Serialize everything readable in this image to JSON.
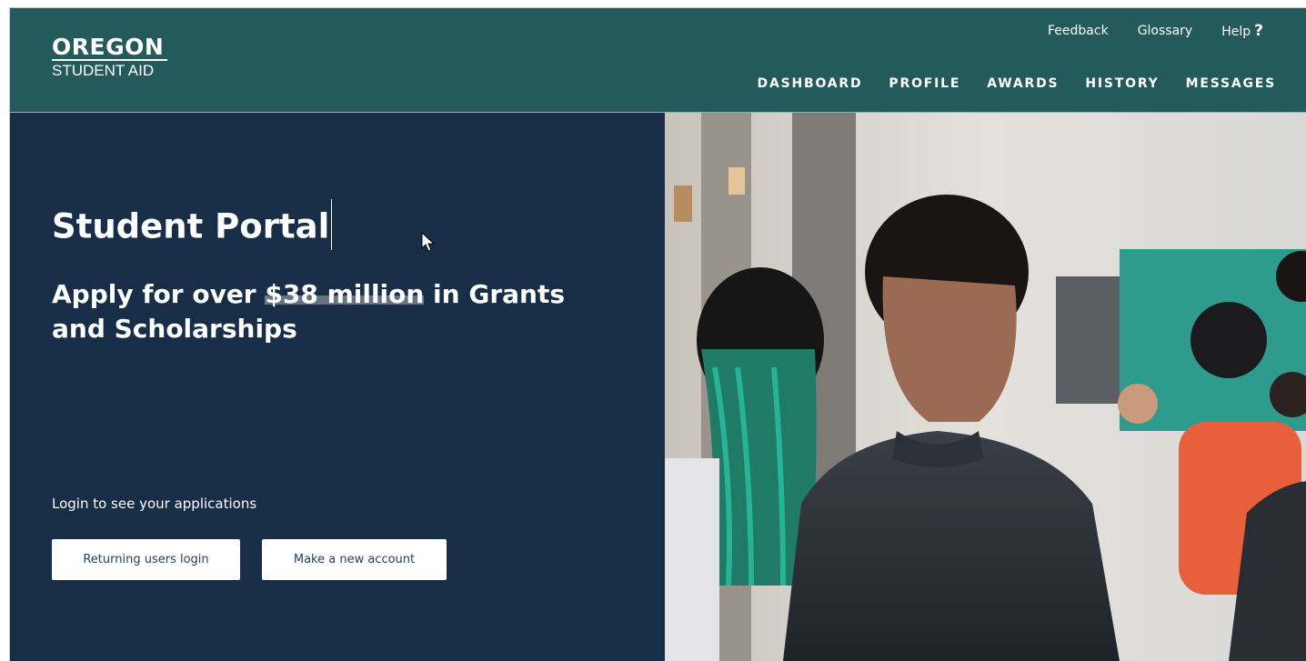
{
  "brand": {
    "line1": "OREGON",
    "line2": "STUDENT AID"
  },
  "utility_nav": {
    "feedback": "Feedback",
    "glossary": "Glossary",
    "help": "Help",
    "help_icon": "question-mark-icon"
  },
  "main_nav": {
    "items": [
      "DASHBOARD",
      "PROFILE",
      "AWARDS",
      "HISTORY",
      "MESSAGES"
    ]
  },
  "hero": {
    "title": "Student Portal",
    "subtitle_pre": "Apply for over ",
    "subtitle_amount": "$38 million",
    "subtitle_post": " in Grants and Scholarships",
    "login_prompt": "Login to see your applications",
    "buttons": {
      "returning": "Returning users login",
      "new_account": "Make a new account"
    },
    "image": "students-in-lecture-hall-photo"
  },
  "colors": {
    "header_bg": "#245a5b",
    "hero_bg": "#182e48",
    "button_bg": "#ffffff",
    "button_text": "#26415f"
  }
}
